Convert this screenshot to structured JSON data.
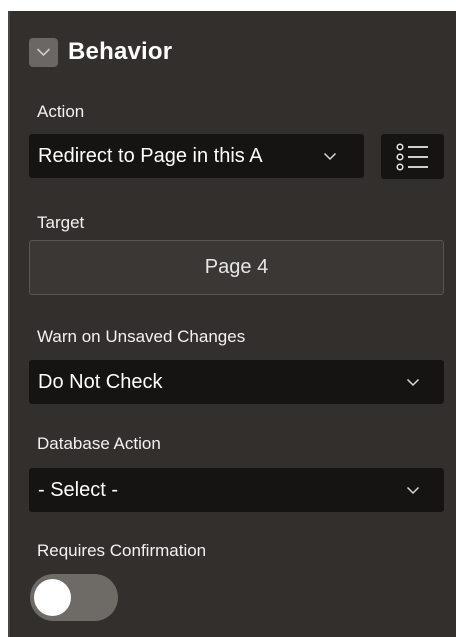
{
  "section": {
    "title": "Behavior",
    "toggle_icon": "chevron-down-icon"
  },
  "action": {
    "label": "Action",
    "value": "Redirect to Page in this A",
    "list_icon": "list-icon"
  },
  "target": {
    "label": "Target",
    "value": "Page 4"
  },
  "warn_unsaved": {
    "label": "Warn on Unsaved Changes",
    "value": "Do Not Check"
  },
  "database_action": {
    "label": "Database Action",
    "value": "- Select -"
  },
  "requires_confirmation": {
    "label": "Requires Confirmation",
    "enabled": false
  },
  "colors": {
    "panel_background": "#332f2c",
    "field_background": "#161412",
    "text": "#f2f2f2"
  }
}
